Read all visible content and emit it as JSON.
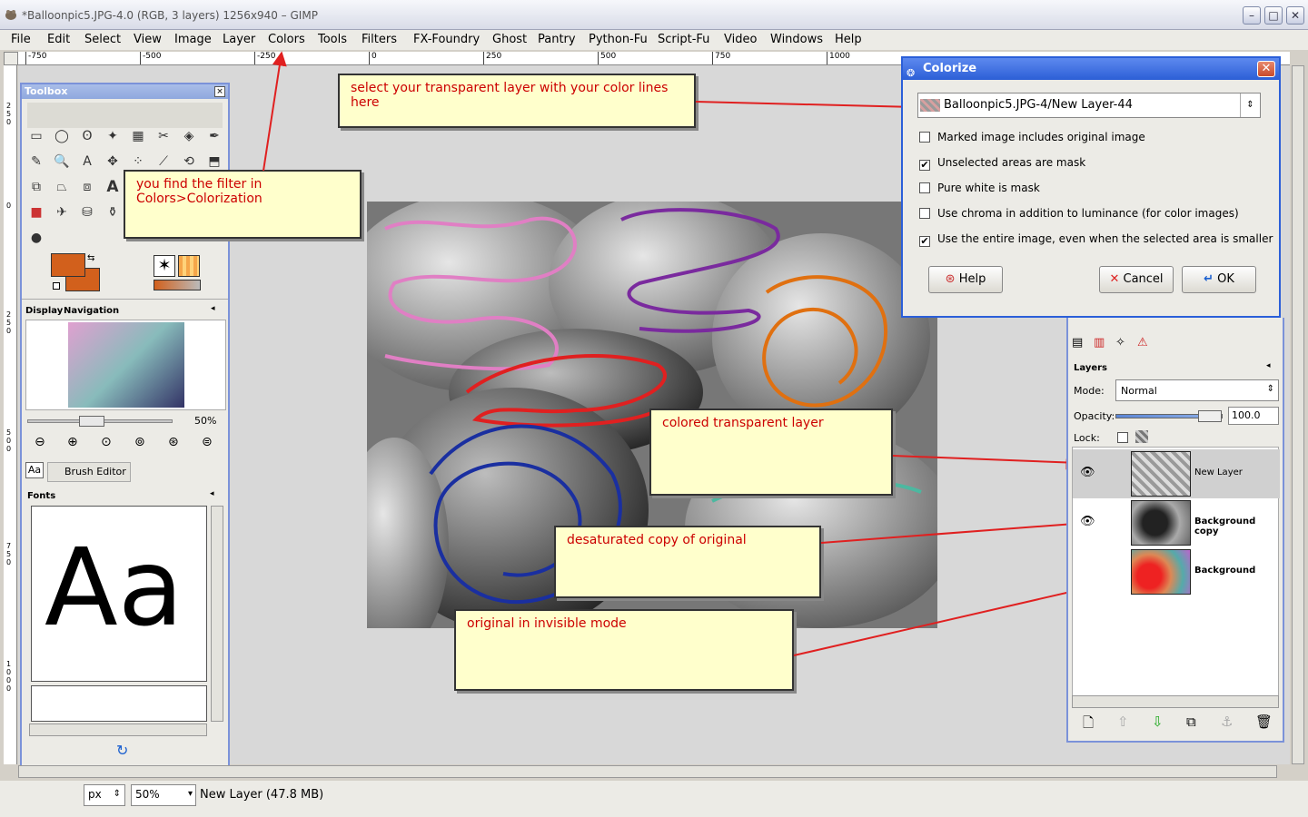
{
  "window": {
    "title": "*Balloonpic5.JPG-4.0 (RGB, 3 layers) 1256x940 – GIMP",
    "minimize": "–",
    "maximize": "□",
    "close": "✕"
  },
  "menu": [
    "File",
    "Edit",
    "Select",
    "View",
    "Image",
    "Layer",
    "Colors",
    "Tools",
    "Filters",
    "FX-Foundry",
    "Ghost",
    "Pantry",
    "Python-Fu",
    "Script-Fu",
    "Video",
    "Windows",
    "Help"
  ],
  "ruler": [
    "-750",
    "-500",
    "-250",
    "0",
    "250",
    "500",
    "750",
    "1000"
  ],
  "ruler_left": [
    "2",
    "5",
    "0",
    "0",
    "2",
    "5",
    "0",
    "5",
    "0",
    "0",
    "7",
    "5",
    "0",
    "1",
    "0",
    "0",
    "0"
  ],
  "toolbox": {
    "title": "Toolbox",
    "tab_display": "Display",
    "tab_navigation": "Navigation",
    "zoom_value": "50%",
    "tab_brush_editor": "Brush Editor",
    "fonts_label": "Fonts",
    "font_preview": "Aa",
    "tab_aa": "Aa"
  },
  "callouts": {
    "select_layer": "select your transparent layer with your color lines here",
    "filter_location_line1": "you find the filter in",
    "filter_location_line2": "Colors>Colorization",
    "colored_layer": "colored transparent layer",
    "desaturated": "desaturated copy of original",
    "original": "original in invisible mode"
  },
  "dialog": {
    "title": "Colorize",
    "layer_combo": "Balloonpic5.JPG-4/New Layer-44",
    "options": [
      {
        "label": "Marked image includes original image",
        "checked": false
      },
      {
        "label": "Unselected areas are mask",
        "checked": true
      },
      {
        "label": "Pure white is mask",
        "checked": false
      },
      {
        "label": "Use chroma in addition to luminance (for color images)",
        "checked": false
      },
      {
        "label": "Use the entire image, even when the selected area is smaller",
        "checked": true
      }
    ],
    "help": "Help",
    "cancel": "Cancel",
    "ok": "OK"
  },
  "layers": {
    "title": "Layers",
    "mode_label": "Mode:",
    "mode_value": "Normal",
    "opacity_label": "Opacity:",
    "opacity_value": "100.0",
    "opacity_fraction": 0.98,
    "lock_label": "Lock:",
    "items": [
      {
        "name": "New Layer",
        "visible": true,
        "selected": true
      },
      {
        "name": "Background copy",
        "visible": true,
        "selected": false
      },
      {
        "name": "Background",
        "visible": false,
        "selected": false
      }
    ]
  },
  "statusbar": {
    "unit": "px",
    "zoom": "50",
    "zoom_suffix": "%",
    "message": "New Layer (47.8 MB)"
  },
  "colors": {
    "fg": "#d2601c",
    "bg": "#d2601c",
    "accent": "#2c5fd6",
    "callout_text": "#cc0000",
    "callout_bg": "#ffffcc"
  }
}
